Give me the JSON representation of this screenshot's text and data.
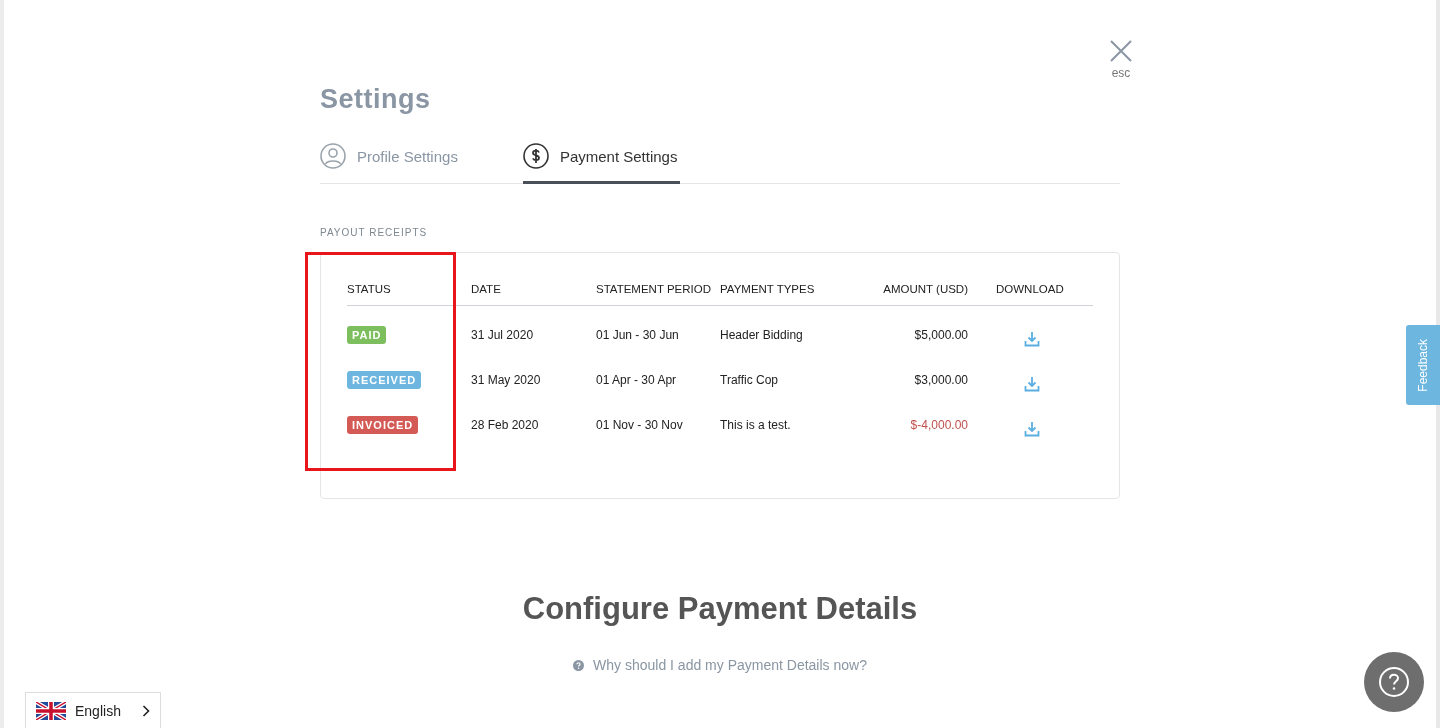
{
  "close": {
    "label": "esc"
  },
  "title": "Settings",
  "tabs": [
    {
      "label": "Profile Settings",
      "selected": false,
      "kind": "profile"
    },
    {
      "label": "Payment Settings",
      "selected": true,
      "kind": "payment"
    }
  ],
  "section_label": "PAYOUT RECEIPTS",
  "table": {
    "columns": [
      "STATUS",
      "DATE",
      "STATEMENT PERIOD",
      "PAYMENT TYPES",
      "AMOUNT (USD)",
      "DOWNLOAD"
    ],
    "rows": [
      {
        "status": "PAID",
        "color": "#7dbf5e",
        "date": "31 Jul 2020",
        "period": "01 Jun - 30 Jun",
        "type": "Header Bidding",
        "amount": "$5,000.00",
        "negative": false
      },
      {
        "status": "RECEIVED",
        "color": "#6cb6e0",
        "date": "31 May 2020",
        "period": "01 Apr - 30 Apr",
        "type": "Traffic Cop",
        "amount": "$3,000.00",
        "negative": false
      },
      {
        "status": "INVOICED",
        "color": "#d45a55",
        "date": "28 Feb 2020",
        "period": "01 Nov - 30 Nov",
        "type": "This is a test.",
        "amount": "$-4,000.00",
        "negative": true
      }
    ]
  },
  "configure": {
    "heading": "Configure Payment Details",
    "help_link": "Why should I add my Payment Details now?"
  },
  "language": {
    "label": "English"
  },
  "feedback": {
    "label": "Feedback"
  }
}
